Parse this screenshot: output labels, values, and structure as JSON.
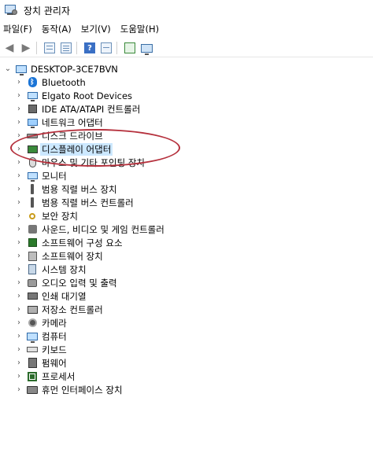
{
  "window": {
    "title": "장치 관리자"
  },
  "menu": [
    "파일(F)",
    "동작(A)",
    "보기(V)",
    "도움말(H)"
  ],
  "toolbar": {
    "back_icon": "back-arrow-icon",
    "forward_icon": "forward-arrow-icon"
  },
  "tree": {
    "root": "DESKTOP-3CE7BVN",
    "items": [
      {
        "label": "Bluetooth",
        "icon": "bluetooth-icon"
      },
      {
        "label": "Elgato Root Devices",
        "icon": "monitor-icon"
      },
      {
        "label": "IDE ATA/ATAPI 컨트롤러",
        "icon": "controller-icon"
      },
      {
        "label": "네트워크 어댑터",
        "icon": "network-adapter-icon"
      },
      {
        "label": "디스크 드라이브",
        "icon": "disk-drive-icon"
      },
      {
        "label": "디스플레이 어댑터",
        "icon": "display-adapter-icon"
      },
      {
        "label": "마우스 및 기타 포인팅 장치",
        "icon": "mouse-icon"
      },
      {
        "label": "모니터",
        "icon": "monitor-icon"
      },
      {
        "label": "범용 직렬 버스 장치",
        "icon": "usb-icon"
      },
      {
        "label": "범용 직렬 버스 컨트롤러",
        "icon": "usb-controller-icon"
      },
      {
        "label": "보안 장치",
        "icon": "security-key-icon"
      },
      {
        "label": "사운드, 비디오 및 게임 컨트롤러",
        "icon": "speaker-icon"
      },
      {
        "label": "소프트웨어 구성 요소",
        "icon": "software-component-icon"
      },
      {
        "label": "소프트웨어 장치",
        "icon": "software-device-icon"
      },
      {
        "label": "시스템 장치",
        "icon": "system-device-icon"
      },
      {
        "label": "오디오 입력 및 출력",
        "icon": "audio-io-icon"
      },
      {
        "label": "인쇄 대기열",
        "icon": "printer-icon"
      },
      {
        "label": "저장소 컨트롤러",
        "icon": "storage-controller-icon"
      },
      {
        "label": "카메라",
        "icon": "camera-icon"
      },
      {
        "label": "컴퓨터",
        "icon": "computer-icon"
      },
      {
        "label": "키보드",
        "icon": "keyboard-icon"
      },
      {
        "label": "펌웨어",
        "icon": "firmware-icon"
      },
      {
        "label": "프로세서",
        "icon": "processor-icon"
      },
      {
        "label": "휴먼 인터페이스 장치",
        "icon": "hid-icon"
      }
    ]
  },
  "highlight_color": "#b5303c",
  "selection_color": "#cce8ff"
}
